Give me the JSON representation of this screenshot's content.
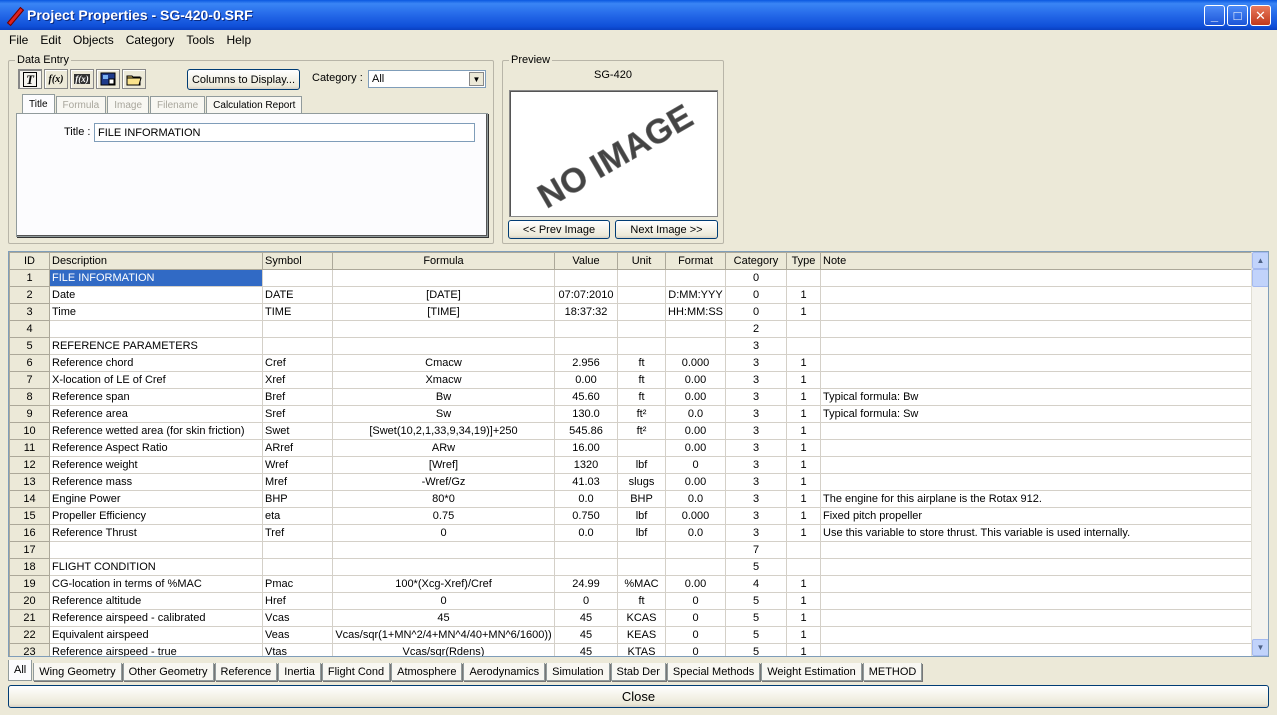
{
  "window": {
    "title": "Project Properties - SG-420-0.SRF",
    "minimize": "_",
    "maximize": "□",
    "close": "✕"
  },
  "menu": [
    "File",
    "Edit",
    "Objects",
    "Category",
    "Tools",
    "Help"
  ],
  "data_entry": {
    "legend": "Data Entry",
    "toolbar": [
      "T",
      "f(x)",
      "f(x)",
      "img",
      "folder"
    ],
    "columns_button": "Columns to Display...",
    "category_label": "Category :",
    "category_value": "All",
    "tabs": [
      {
        "label": "Title",
        "state": "active"
      },
      {
        "label": "Formula",
        "state": "disabled"
      },
      {
        "label": "Image",
        "state": "disabled"
      },
      {
        "label": "Filename",
        "state": "disabled"
      },
      {
        "label": "Calculation Report",
        "state": "normal"
      }
    ],
    "title_label": "Title :",
    "title_value": "FILE INFORMATION"
  },
  "preview": {
    "legend": "Preview",
    "name": "SG-420",
    "placeholder": "NO IMAGE",
    "prev_button": "<< Prev Image",
    "next_button": "Next Image >>"
  },
  "grid": {
    "columns": [
      "ID",
      "Description",
      "Symbol",
      "Formula",
      "Value",
      "Unit",
      "Format",
      "Category",
      "Type",
      "Note"
    ],
    "rows": [
      [
        "1",
        "FILE INFORMATION",
        "",
        "",
        "",
        "",
        "",
        "0",
        "",
        ""
      ],
      [
        "2",
        "Date",
        "DATE",
        "[DATE]",
        "07:07:2010",
        "",
        "D:MM:YYY",
        "0",
        "1",
        ""
      ],
      [
        "3",
        "Time",
        "TIME",
        "[TIME]",
        "18:37:32",
        "",
        "HH:MM:SS",
        "0",
        "1",
        ""
      ],
      [
        "4",
        "",
        "",
        "",
        "",
        "",
        "",
        "2",
        "",
        ""
      ],
      [
        "5",
        "REFERENCE PARAMETERS",
        "",
        "",
        "",
        "",
        "",
        "3",
        "",
        ""
      ],
      [
        "6",
        "Reference chord",
        "Cref",
        "Cmacw",
        "2.956",
        "ft",
        "0.000",
        "3",
        "1",
        ""
      ],
      [
        "7",
        "X-location of LE of Cref",
        "Xref",
        "Xmacw",
        "0.00",
        "ft",
        "0.00",
        "3",
        "1",
        ""
      ],
      [
        "8",
        "Reference span",
        "Bref",
        "Bw",
        "45.60",
        "ft",
        "0.00",
        "3",
        "1",
        "Typical formula: Bw"
      ],
      [
        "9",
        "Reference area",
        "Sref",
        "Sw",
        "130.0",
        "ft²",
        "0.0",
        "3",
        "1",
        "Typical formula: Sw"
      ],
      [
        "10",
        "Reference wetted area (for skin friction)",
        "Swet",
        "[Swet(10,2,1,33,9,34,19)]+250",
        "545.86",
        "ft²",
        "0.00",
        "3",
        "1",
        ""
      ],
      [
        "11",
        "Reference Aspect Ratio",
        "ARref",
        "ARw",
        "16.00",
        "",
        "0.00",
        "3",
        "1",
        ""
      ],
      [
        "12",
        "Reference weight",
        "Wref",
        "[Wref]",
        "1320",
        "lbf",
        "0",
        "3",
        "1",
        ""
      ],
      [
        "13",
        "Reference mass",
        "Mref",
        "-Wref/Gz",
        "41.03",
        "slugs",
        "0.00",
        "3",
        "1",
        ""
      ],
      [
        "14",
        "Engine Power",
        "BHP",
        "80*0",
        "0.0",
        "BHP",
        "0.0",
        "3",
        "1",
        "The engine for this airplane is the Rotax 912."
      ],
      [
        "15",
        "Propeller Efficiency",
        "eta",
        "0.75",
        "0.750",
        "lbf",
        "0.000",
        "3",
        "1",
        "Fixed pitch propeller"
      ],
      [
        "16",
        "Reference Thrust",
        "Tref",
        "0",
        "0.0",
        "lbf",
        "0.0",
        "3",
        "1",
        "Use this variable to store thrust. This variable is used internally."
      ],
      [
        "17",
        "",
        "",
        "",
        "",
        "",
        "",
        "7",
        "",
        ""
      ],
      [
        "18",
        "FLIGHT CONDITION",
        "",
        "",
        "",
        "",
        "",
        "5",
        "",
        ""
      ],
      [
        "19",
        "CG-location in terms of %MAC",
        "Pmac",
        "100*(Xcg-Xref)/Cref",
        "24.99",
        "%MAC",
        "0.00",
        "4",
        "1",
        ""
      ],
      [
        "20",
        "Reference altitude",
        "Href",
        "0",
        "0",
        "ft",
        "0",
        "5",
        "1",
        ""
      ],
      [
        "21",
        "Reference airspeed - calibrated",
        "Vcas",
        "45",
        "45",
        "KCAS",
        "0",
        "5",
        "1",
        ""
      ],
      [
        "22",
        "Equivalent airspeed",
        "Veas",
        "Vcas/sqr(1+MN^2/4+MN^4/40+MN^6/1600))",
        "45",
        "KEAS",
        "0",
        "5",
        "1",
        ""
      ],
      [
        "23",
        "Reference airspeed - true",
        "Vtas",
        "Vcas/sqr(Rdens)",
        "45",
        "KTAS",
        "0",
        "5",
        "1",
        ""
      ]
    ]
  },
  "bottom_tabs": [
    "All",
    "Wing Geometry",
    "Other Geometry",
    "Reference",
    "Inertia",
    "Flight Cond",
    "Atmosphere",
    "Aerodynamics",
    "Simulation",
    "Stab Der",
    "Special Methods",
    "Weight Estimation",
    "METHOD"
  ],
  "close_button": "Close",
  "colors": {
    "selection": "#316ac5",
    "titlebar": "#0a58e0"
  }
}
